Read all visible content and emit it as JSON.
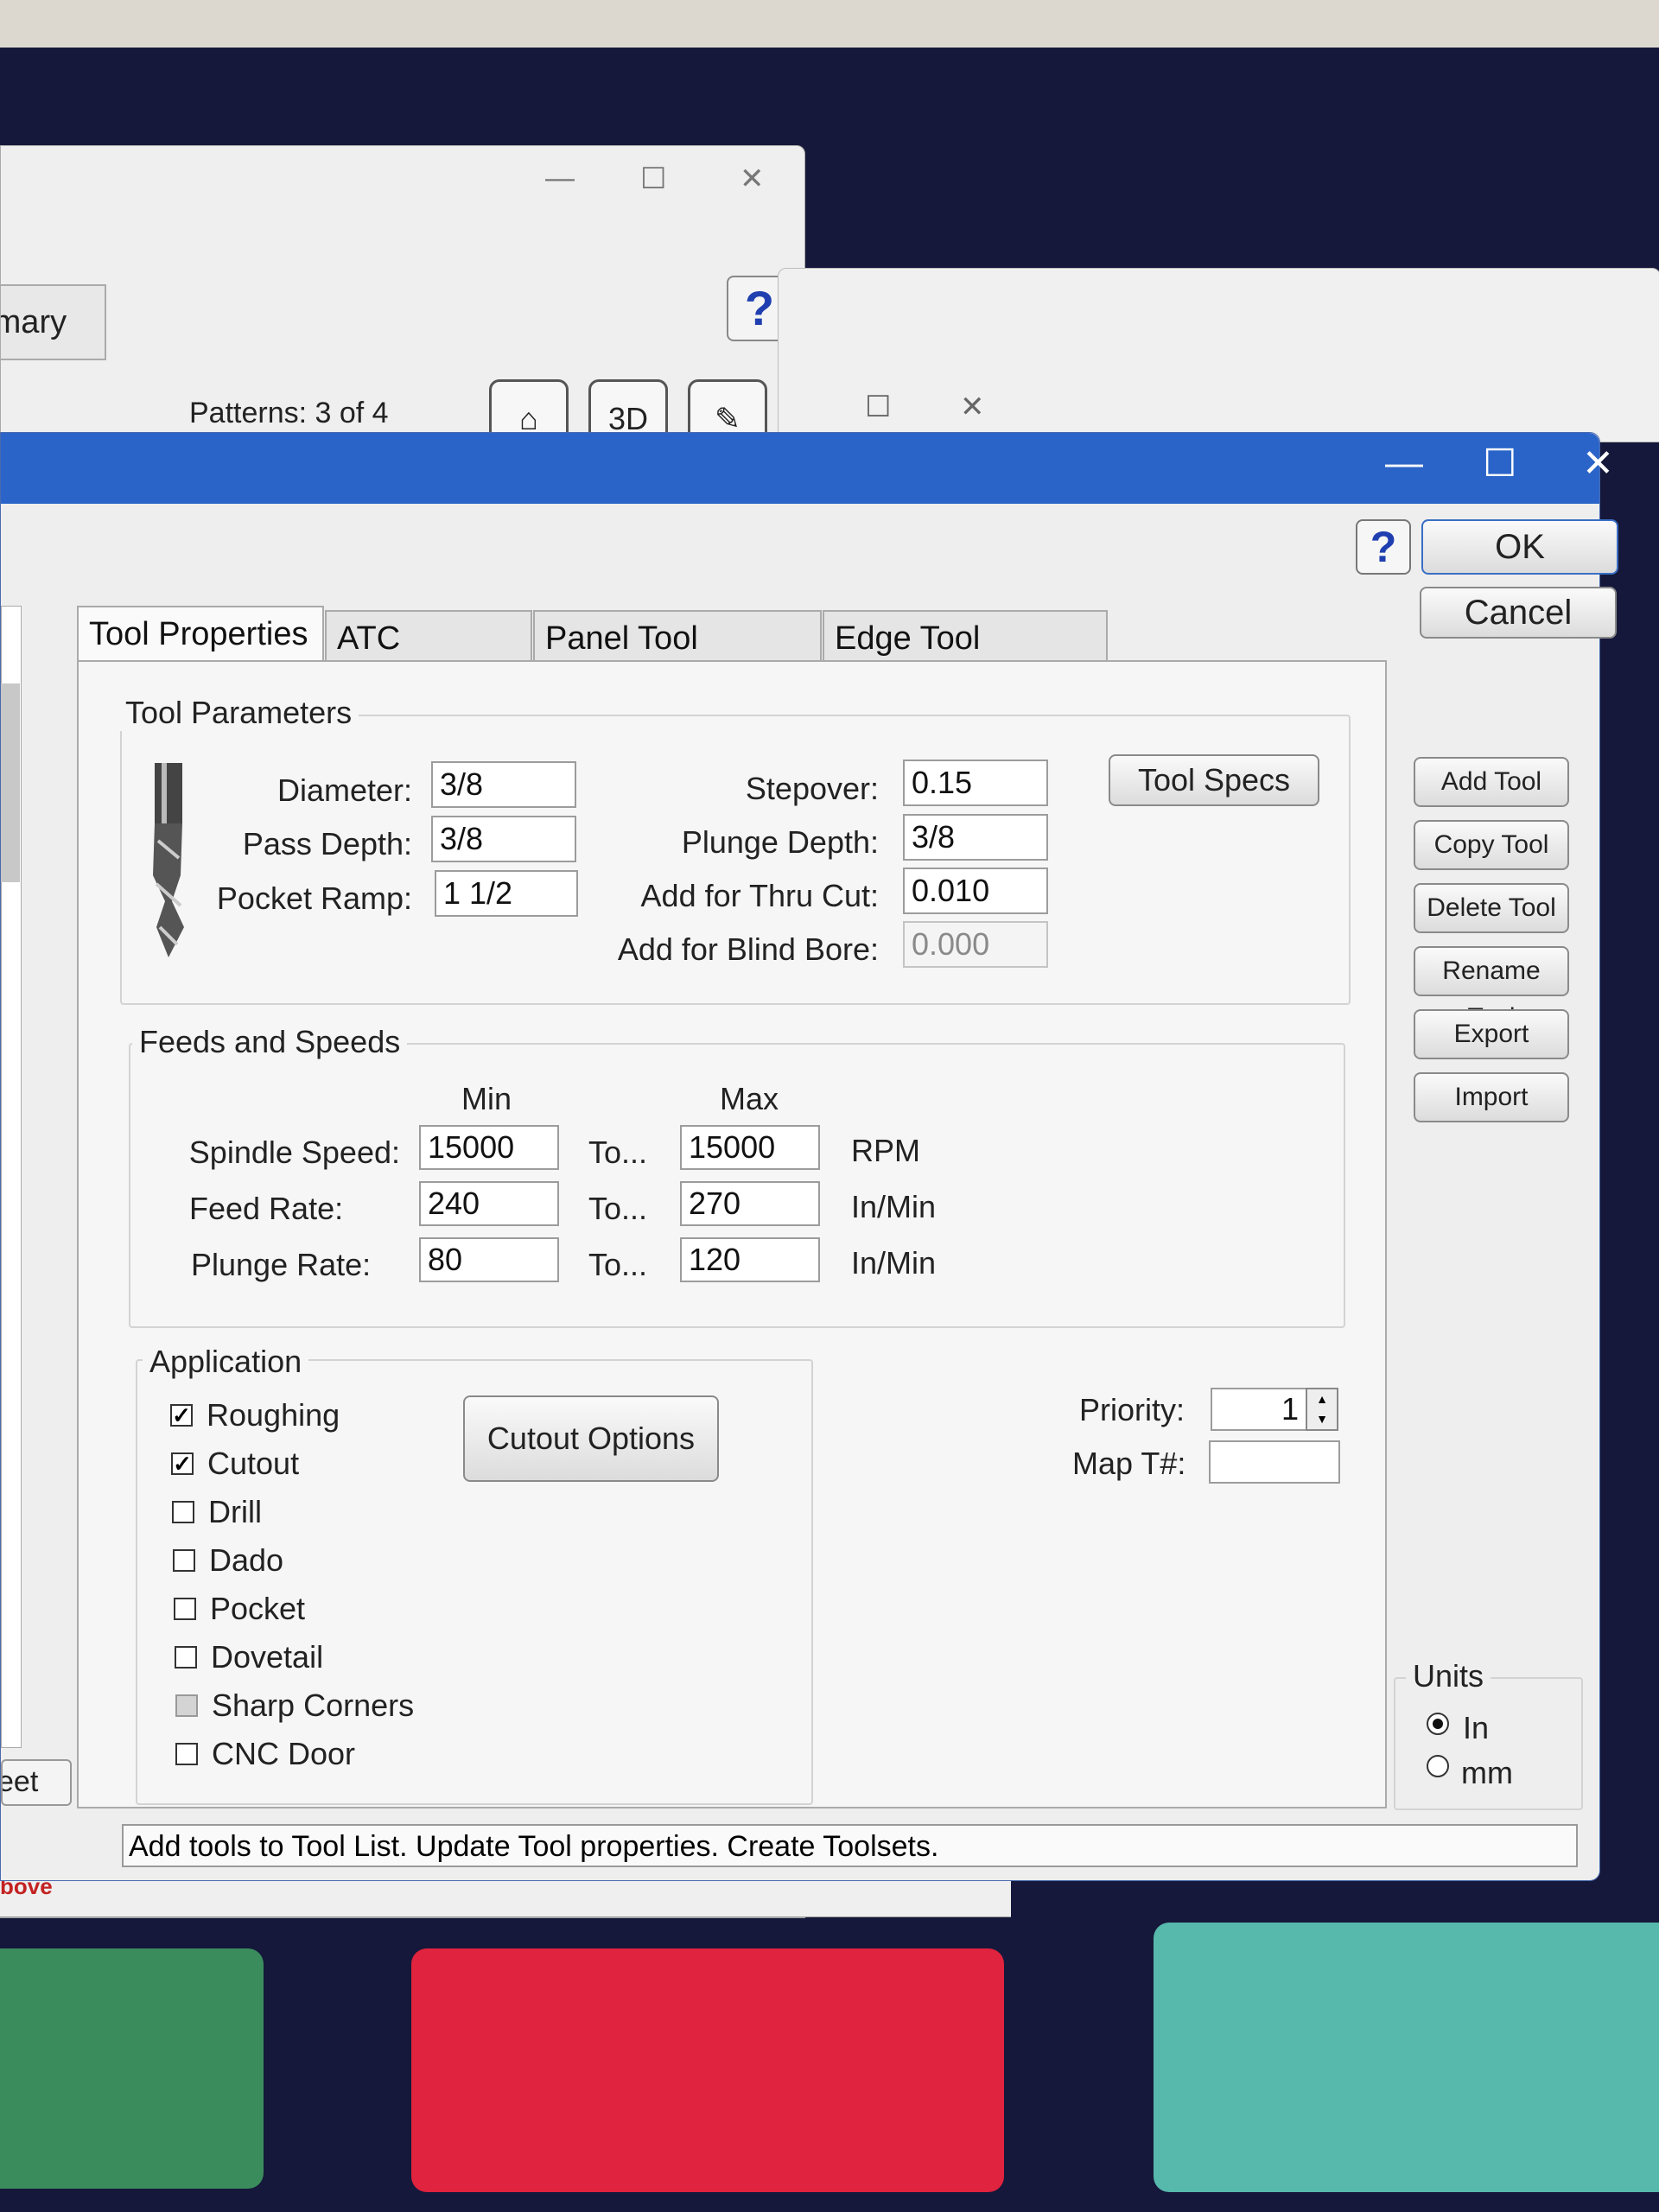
{
  "back_window": {
    "summary_tab": "mmary",
    "patterns_label": "Patterns: 3 of 4",
    "help": "?",
    "bottom_text": "bove",
    "toolbar_3d": "3D"
  },
  "dialog": {
    "help": "?",
    "ok": "OK",
    "cancel": "Cancel",
    "side_buttons": [
      "Add Tool",
      "Copy Tool",
      "Delete Tool",
      "Rename Tool",
      "Export",
      "Import"
    ],
    "left_bottom_button": "eet",
    "tabs": [
      "Tool Properties",
      "ATC Toolsets",
      "Panel Tool Groups",
      "Edge Tool Groups"
    ],
    "tool_parameters": {
      "title": "Tool Parameters",
      "diameter_label": "Diameter:",
      "diameter": "3/8",
      "pass_depth_label": "Pass Depth:",
      "pass_depth": "3/8",
      "pocket_ramp_label": "Pocket Ramp:",
      "pocket_ramp": "1 1/2",
      "stepover_label": "Stepover:",
      "stepover": "0.15",
      "plunge_depth_label": "Plunge Depth:",
      "plunge_depth": "3/8",
      "thru_cut_label": "Add for Thru Cut:",
      "thru_cut": "0.010",
      "blind_bore_label": "Add for Blind Bore:",
      "blind_bore": "0.000",
      "tool_specs_button": "Tool Specs"
    },
    "feeds": {
      "title": "Feeds and Speeds",
      "min_header": "Min",
      "max_header": "Max",
      "to": "To...",
      "spindle_label": "Spindle Speed:",
      "spindle_min": "15000",
      "spindle_max": "15000",
      "spindle_unit": "RPM",
      "feed_label": "Feed Rate:",
      "feed_min": "240",
      "feed_max": "270",
      "feed_unit": "In/Min",
      "plunge_label": "Plunge Rate:",
      "plunge_min": "80",
      "plunge_max": "120",
      "plunge_unit": "In/Min"
    },
    "application": {
      "title": "Application",
      "items": [
        {
          "label": "Roughing",
          "checked": true
        },
        {
          "label": "Cutout",
          "checked": true
        },
        {
          "label": "Drill",
          "checked": false
        },
        {
          "label": "Dado",
          "checked": false
        },
        {
          "label": "Pocket",
          "checked": false
        },
        {
          "label": "Dovetail",
          "checked": false
        },
        {
          "label": "Sharp Corners",
          "checked": false
        },
        {
          "label": "CNC Door",
          "checked": false
        }
      ],
      "cutout_options_button": "Cutout Options"
    },
    "priority_label": "Priority:",
    "priority": "1",
    "map_label": "Map T#:",
    "map_value": "",
    "units": {
      "title": "Units",
      "in": "In",
      "mm": "mm",
      "selected": "In"
    },
    "status": "Add tools to Tool List. Update Tool properties. Create Toolsets."
  }
}
